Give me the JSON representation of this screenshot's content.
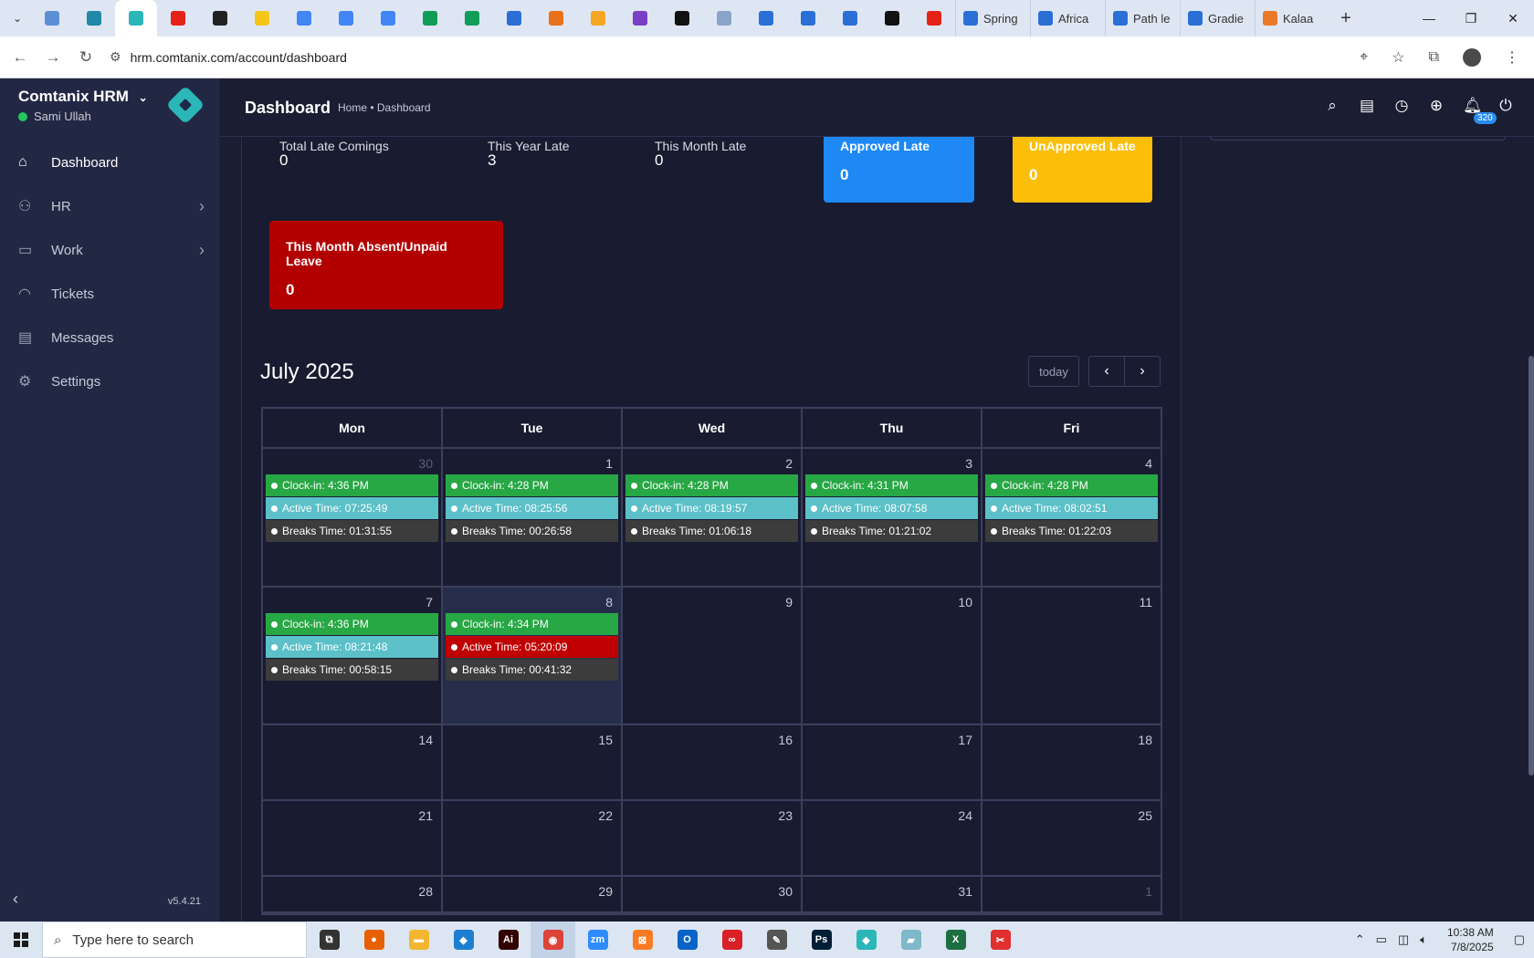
{
  "browser": {
    "pinned_tabs": [
      {
        "name": "tab-favicon-1",
        "color": "#5a8fd6"
      },
      {
        "name": "tab-favicon-2",
        "color": "#1e88a8"
      },
      {
        "name": "tab-favicon-hrm",
        "color": "#2bb6b8",
        "active": true
      },
      {
        "name": "tab-favicon-youtube",
        "color": "#e62117"
      },
      {
        "name": "tab-favicon-5",
        "color": "#222222"
      },
      {
        "name": "tab-favicon-6",
        "color": "#f5c518"
      },
      {
        "name": "tab-favicon-docs",
        "color": "#4285f4"
      },
      {
        "name": "tab-favicon-docs",
        "color": "#4285f4"
      },
      {
        "name": "tab-favicon-docs",
        "color": "#4285f4"
      },
      {
        "name": "tab-favicon-sheets",
        "color": "#0f9d58"
      },
      {
        "name": "tab-favicon-sheets",
        "color": "#0f9d58"
      },
      {
        "name": "tab-favicon-12",
        "color": "#2b6fd6"
      },
      {
        "name": "tab-favicon-13",
        "color": "#e8711a"
      },
      {
        "name": "tab-favicon-14",
        "color": "#f5a623"
      },
      {
        "name": "tab-favicon-15",
        "color": "#7b3fc4"
      },
      {
        "name": "tab-favicon-16",
        "color": "#111111"
      },
      {
        "name": "tab-favicon-17",
        "color": "#8aa4c8"
      },
      {
        "name": "tab-favicon-forms",
        "color": "#2a6fd6"
      },
      {
        "name": "tab-favicon-forms",
        "color": "#2a6fd6"
      },
      {
        "name": "tab-favicon-forms",
        "color": "#2a6fd6"
      },
      {
        "name": "tab-favicon-medium",
        "color": "#111111"
      },
      {
        "name": "tab-favicon-youtube",
        "color": "#e62117"
      }
    ],
    "named_tabs": [
      "Spring",
      "Africa",
      "Path le",
      "Gradie",
      "Kalaa"
    ],
    "url": "hrm.comtanix.com/account/dashboard"
  },
  "sidebar": {
    "brand": "Comtanix HRM",
    "user": "Sami Ullah",
    "items": [
      {
        "label": "Dashboard",
        "icon": "home-icon",
        "has_chevron": false
      },
      {
        "label": "HR",
        "icon": "users-icon",
        "has_chevron": true
      },
      {
        "label": "Work",
        "icon": "briefcase-icon",
        "has_chevron": true
      },
      {
        "label": "Tickets",
        "icon": "headset-icon",
        "has_chevron": false
      },
      {
        "label": "Messages",
        "icon": "message-icon",
        "has_chevron": false
      },
      {
        "label": "Settings",
        "icon": "gear-icon",
        "has_chevron": false
      }
    ],
    "version": "v5.4.21"
  },
  "header": {
    "title": "Dashboard",
    "breadcrumb": "Home • Dashboard",
    "notification_count": "320"
  },
  "stats": [
    {
      "label": "Total Late Comings",
      "value": "0"
    },
    {
      "label": "This Year Late",
      "value": "3"
    },
    {
      "label": "This Month Late",
      "value": "0"
    }
  ],
  "cards": [
    {
      "title": "Approved Late",
      "value": "0",
      "color": "#1e88f5"
    },
    {
      "title": "UnApproved Late",
      "value": "0",
      "color": "#fbbf0a"
    },
    {
      "title": "This Month Absent/Unpaid Leave",
      "value": "0",
      "color": "#b30000"
    }
  ],
  "calendar": {
    "title": "July 2025",
    "today_label": "today",
    "weekdays": [
      "Mon",
      "Tue",
      "Wed",
      "Thu",
      "Fri"
    ],
    "weeks": [
      {
        "days": [
          {
            "num": "30",
            "dim": true,
            "events": [
              {
                "t": "Clock-in: 4:36 PM",
                "c": "green"
              },
              {
                "t": "Active Time: 07:25:49",
                "c": "teal"
              },
              {
                "t": "Breaks Time: 01:31:55",
                "c": "dark"
              }
            ]
          },
          {
            "num": "1",
            "events": [
              {
                "t": "Clock-in: 4:28 PM",
                "c": "green"
              },
              {
                "t": "Active Time: 08:25:56",
                "c": "teal"
              },
              {
                "t": "Breaks Time: 00:26:58",
                "c": "dark"
              }
            ]
          },
          {
            "num": "2",
            "events": [
              {
                "t": "Clock-in: 4:28 PM",
                "c": "green"
              },
              {
                "t": "Active Time: 08:19:57",
                "c": "teal"
              },
              {
                "t": "Breaks Time: 01:06:18",
                "c": "dark"
              }
            ]
          },
          {
            "num": "3",
            "events": [
              {
                "t": "Clock-in: 4:31 PM",
                "c": "green"
              },
              {
                "t": "Active Time: 08:07:58",
                "c": "teal"
              },
              {
                "t": "Breaks Time: 01:21:02",
                "c": "dark"
              }
            ]
          },
          {
            "num": "4",
            "events": [
              {
                "t": "Clock-in: 4:28 PM",
                "c": "green"
              },
              {
                "t": "Active Time: 08:02:51",
                "c": "teal"
              },
              {
                "t": "Breaks Time: 01:22:03",
                "c": "dark"
              }
            ]
          }
        ]
      },
      {
        "days": [
          {
            "num": "7",
            "events": [
              {
                "t": "Clock-in: 4:36 PM",
                "c": "green"
              },
              {
                "t": "Active Time: 08:21:48",
                "c": "teal"
              },
              {
                "t": "Breaks Time: 00:58:15",
                "c": "dark"
              }
            ]
          },
          {
            "num": "8",
            "today": true,
            "events": [
              {
                "t": "Clock-in: 4:34 PM",
                "c": "green"
              },
              {
                "t": "Active Time: 05:20:09",
                "c": "red"
              },
              {
                "t": "Breaks Time: 00:41:32",
                "c": "dark"
              }
            ]
          },
          {
            "num": "9",
            "events": []
          },
          {
            "num": "10",
            "events": []
          },
          {
            "num": "11",
            "events": []
          }
        ]
      },
      {
        "days": [
          {
            "num": "14",
            "events": []
          },
          {
            "num": "15",
            "events": []
          },
          {
            "num": "16",
            "events": []
          },
          {
            "num": "17",
            "events": []
          },
          {
            "num": "18",
            "events": []
          }
        ]
      },
      {
        "days": [
          {
            "num": "21",
            "events": []
          },
          {
            "num": "22",
            "events": []
          },
          {
            "num": "23",
            "events": []
          },
          {
            "num": "24",
            "events": []
          },
          {
            "num": "25",
            "events": []
          }
        ]
      },
      {
        "days": [
          {
            "num": "28",
            "events": []
          },
          {
            "num": "29",
            "events": []
          },
          {
            "num": "30",
            "events": []
          },
          {
            "num": "31",
            "events": []
          },
          {
            "num": "1",
            "dim": true,
            "events": []
          }
        ]
      }
    ]
  },
  "taskbar": {
    "search_placeholder": "Type here to search",
    "apps": [
      {
        "name": "task-view-icon",
        "color": "#333333",
        "glyph": "⧉"
      },
      {
        "name": "firefox-icon",
        "color": "#e66000",
        "glyph": "●"
      },
      {
        "name": "file-explorer-icon",
        "color": "#f2b630",
        "glyph": "▬"
      },
      {
        "name": "vscode-icon",
        "color": "#1e7fd0",
        "glyph": "◆"
      },
      {
        "name": "illustrator-icon",
        "color": "#330000",
        "glyph": "Ai"
      },
      {
        "name": "chrome-icon",
        "color": "#db4437",
        "glyph": "◉",
        "active": true
      },
      {
        "name": "zoom-icon",
        "color": "#2d8cff",
        "glyph": "zm"
      },
      {
        "name": "xampp-icon",
        "color": "#fb7a24",
        "glyph": "⊠"
      },
      {
        "name": "outlook-icon",
        "color": "#0a64c8",
        "glyph": "O"
      },
      {
        "name": "creative-cloud-icon",
        "color": "#da1f26",
        "glyph": "∞"
      },
      {
        "name": "pen-tool-icon",
        "color": "#555555",
        "glyph": "✎"
      },
      {
        "name": "photoshop-icon",
        "color": "#001e36",
        "glyph": "Ps"
      },
      {
        "name": "hrm-app-icon",
        "color": "#2bb6b8",
        "glyph": "◆"
      },
      {
        "name": "notes-app-icon",
        "color": "#7fb8c8",
        "glyph": "▰"
      },
      {
        "name": "excel-icon",
        "color": "#1d6f42",
        "glyph": "X"
      },
      {
        "name": "xmind-icon",
        "color": "#e03030",
        "glyph": "✂"
      }
    ],
    "time": "10:38 AM",
    "date": "7/8/2025"
  }
}
